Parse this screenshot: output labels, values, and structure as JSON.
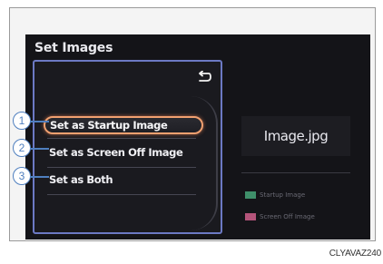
{
  "screen": {
    "title": "Set Images",
    "menu_items": [
      {
        "label": "Set as Startup Image",
        "focused": true
      },
      {
        "label": "Set as Screen Off Image",
        "focused": false
      },
      {
        "label": "Set as Both",
        "focused": false
      }
    ],
    "preview_filename": "Image.jpg",
    "legend": [
      {
        "label": "Startup Image",
        "color": "#3f8f6a"
      },
      {
        "label": "Screen Off Image",
        "color": "#b4547a"
      }
    ]
  },
  "callouts": [
    "1",
    "2",
    "3"
  ],
  "figure_code": "CLYAVAZ240"
}
